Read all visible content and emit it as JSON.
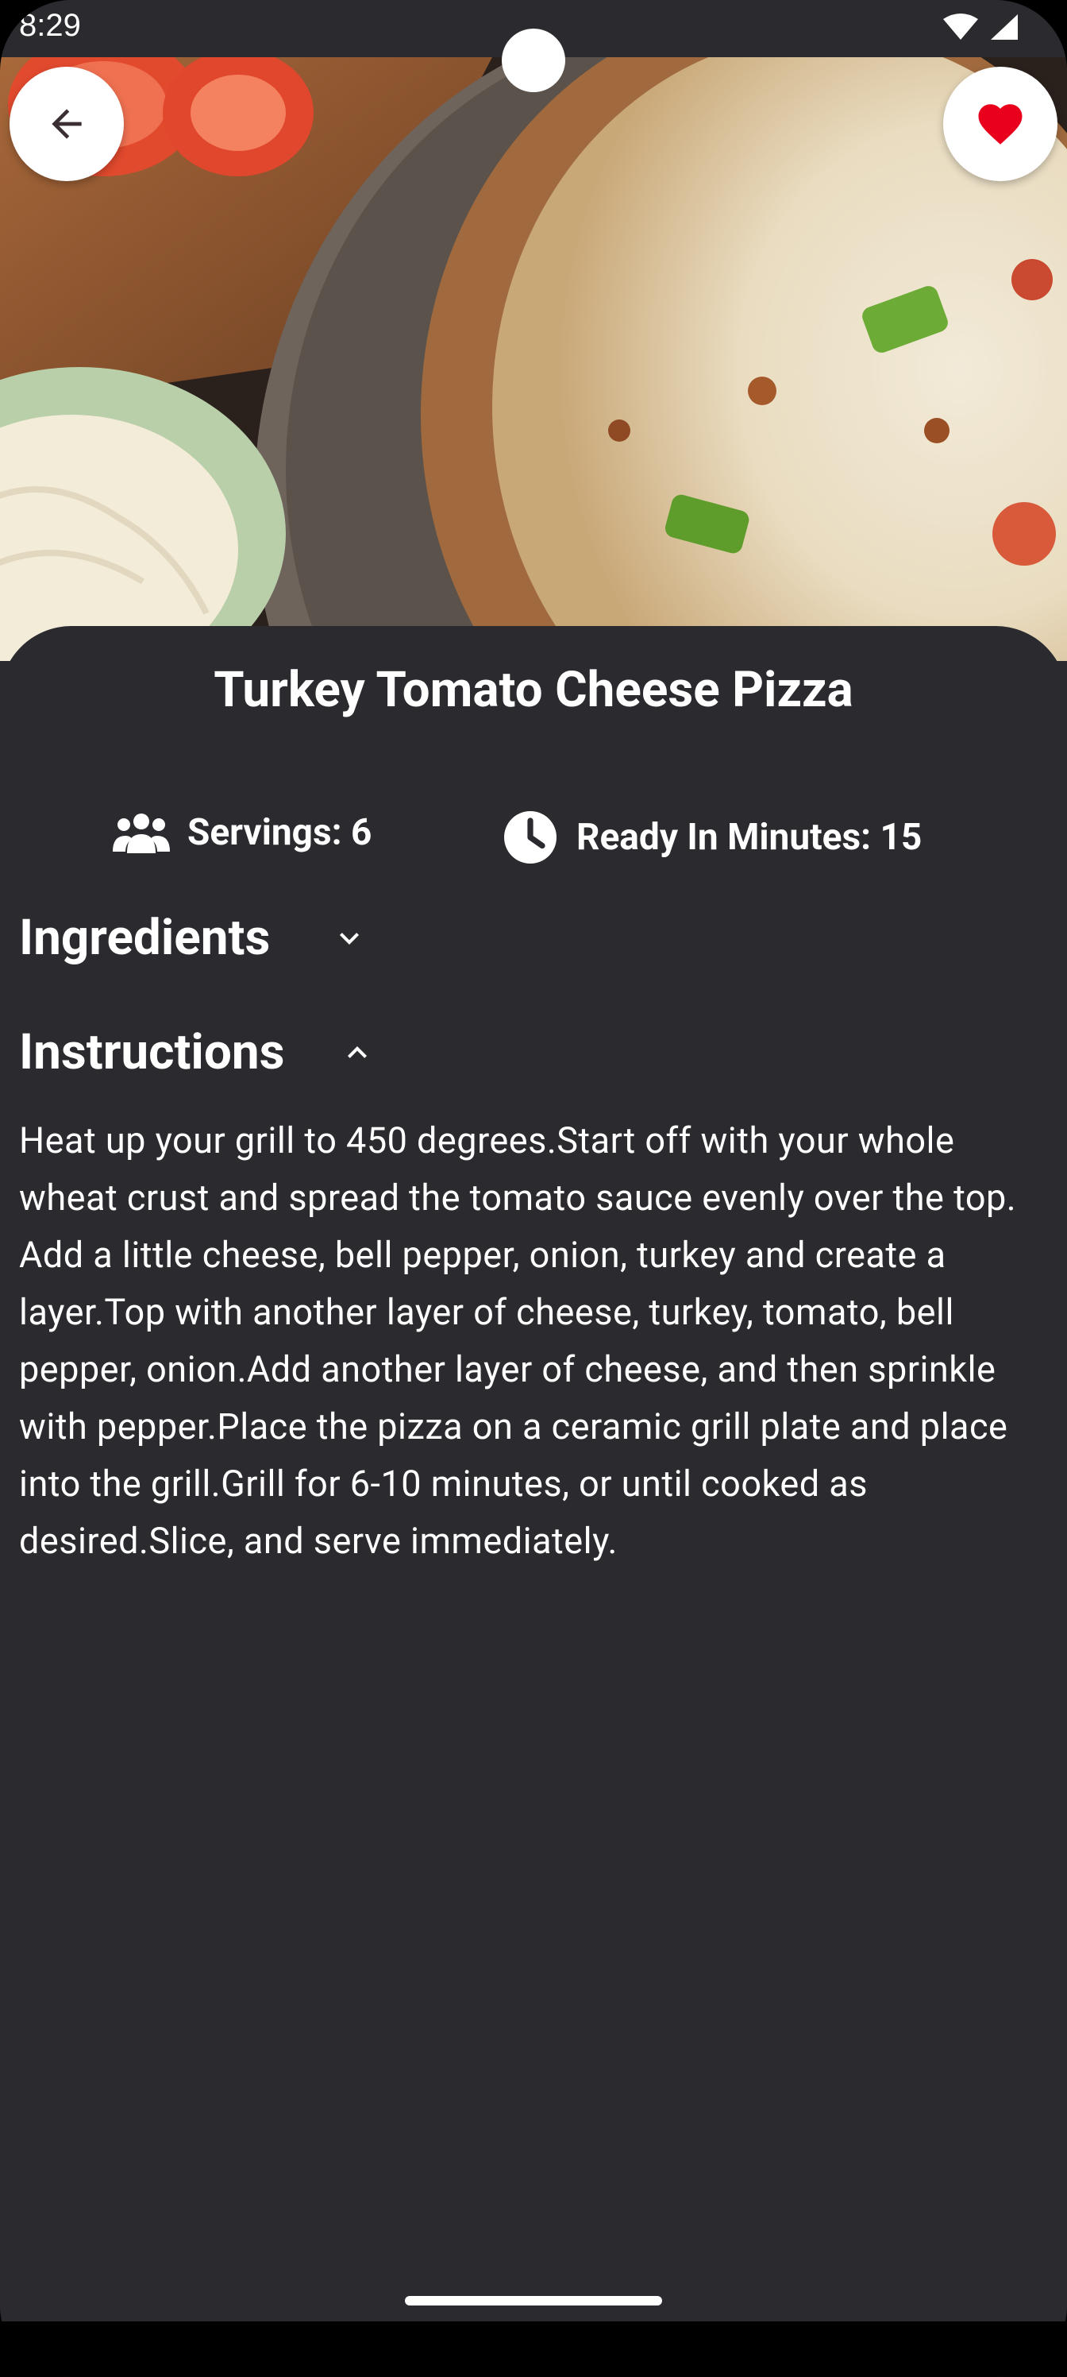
{
  "status_bar": {
    "time": "8:29"
  },
  "hero": {
    "image_description_icon": "pizza-photo"
  },
  "actions": {
    "back_icon": "arrow-left-icon",
    "favorite_icon": "heart-icon",
    "favorite_color": "#e8001c"
  },
  "recipe": {
    "title": "Turkey Tomato Cheese Pizza",
    "servings_label": "Servings: 6",
    "ready_label": "Ready In Minutes: 15"
  },
  "sections": {
    "ingredients_label": "Ingredients",
    "ingredients_state": "collapsed",
    "instructions_label": "Instructions",
    "instructions_state": "expanded",
    "instructions_text": "Heat up your grill to 450 degrees.Start off with your whole wheat crust and spread the tomato sauce evenly over the top. Add a little cheese, bell pepper, onion, turkey and create a layer.Top with another layer of cheese, turkey, tomato, bell pepper, onion.Add another layer of cheese, and then sprinkle with pepper.Place the pizza on a ceramic grill plate and place into the grill.Grill for 6-10 minutes, or until cooked as desired.Slice, and serve immediately."
  },
  "colors": {
    "background": "#2a2a2f",
    "text": "#ffffff",
    "button_bg": "#ffffff"
  }
}
